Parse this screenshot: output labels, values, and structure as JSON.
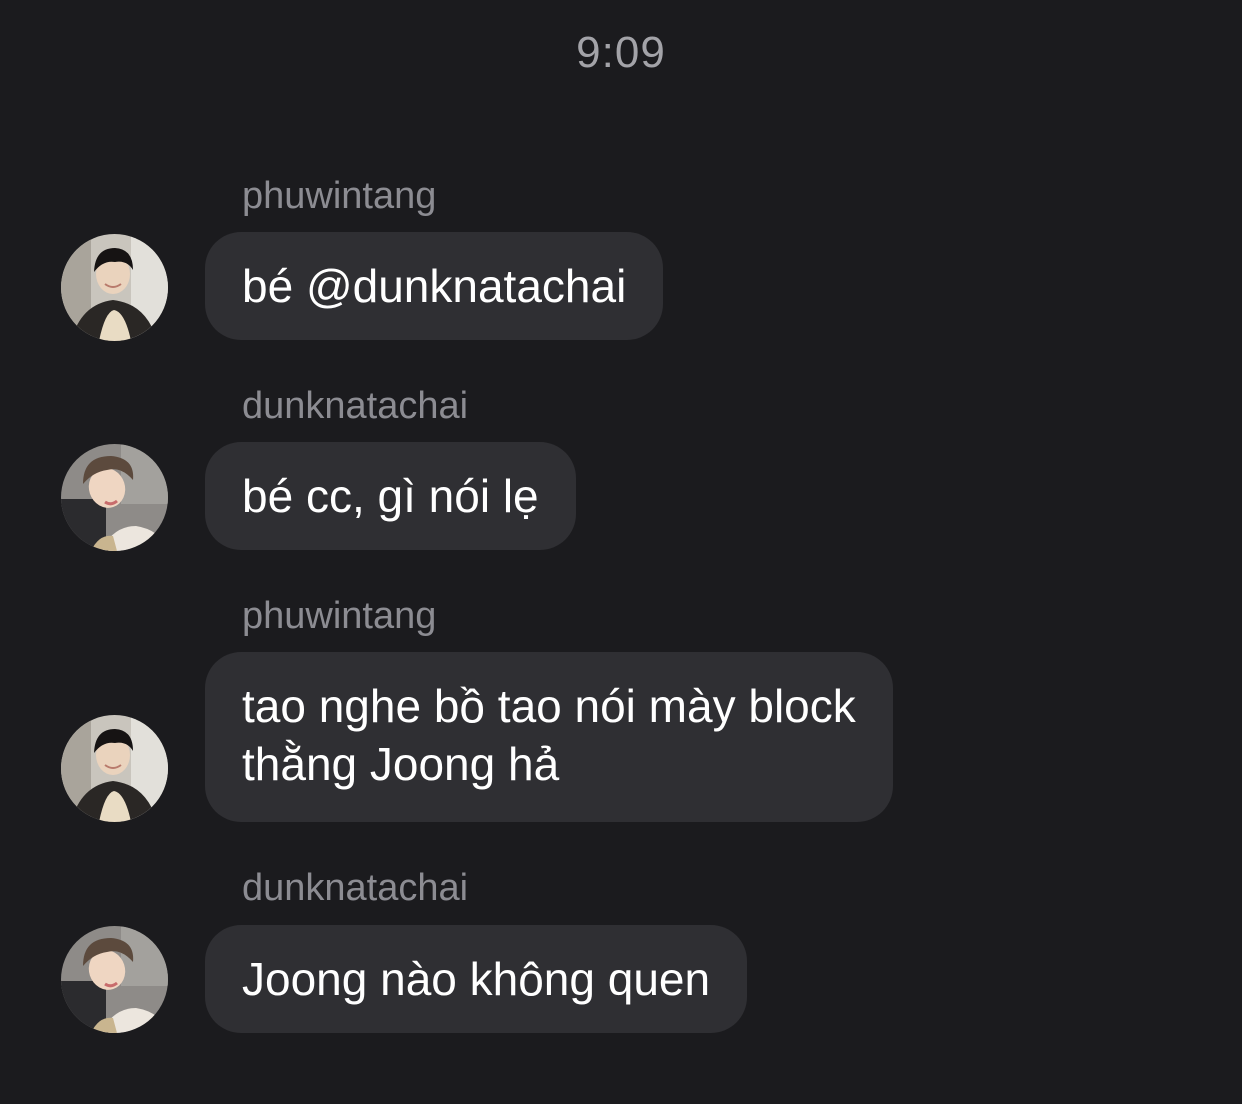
{
  "chat": {
    "timestamp": "9:09",
    "messages": [
      {
        "sender": "phuwintang",
        "text_lines": [
          "bé @dunknatachai"
        ],
        "avatar": "phuwintang-avatar"
      },
      {
        "sender": "dunknatachai",
        "text_lines": [
          "bé cc, gì nói lẹ"
        ],
        "avatar": "dunknatachai-avatar"
      },
      {
        "sender": "phuwintang",
        "text_lines": [
          "tao nghe bồ tao nói mày block",
          "thằng Joong hả"
        ],
        "avatar": "phuwintang-avatar"
      },
      {
        "sender": "dunknatachai",
        "text_lines": [
          "Joong nào không quen"
        ],
        "avatar": "dunknatachai-avatar"
      }
    ]
  },
  "colors": {
    "background": "#1b1b1e",
    "bubble": "#2f2f33",
    "message_text": "#ffffff",
    "sender_text": "#8c8c92",
    "timestamp_text": "#a3a3a8"
  }
}
